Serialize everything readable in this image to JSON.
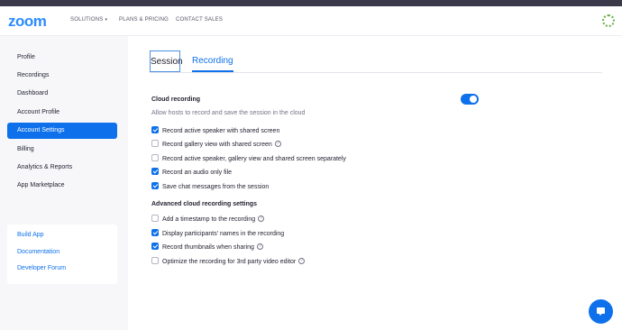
{
  "header": {
    "logo": "zoom",
    "nav": [
      {
        "label": "SOLUTIONS",
        "caret": "▾"
      },
      {
        "label": "PLANS & PRICING"
      },
      {
        "label": "CONTACT SALES"
      }
    ]
  },
  "sidebar": {
    "items": [
      {
        "label": "Profile",
        "active": false
      },
      {
        "label": "Recordings",
        "active": false
      },
      {
        "label": "Dashboard",
        "active": false
      },
      {
        "label": "Account Profile",
        "active": false
      },
      {
        "label": "Account Settings",
        "active": true
      },
      {
        "label": "Billing",
        "active": false
      },
      {
        "label": "Analytics & Reports",
        "active": false
      },
      {
        "label": "App Marketplace",
        "active": false
      }
    ],
    "links": [
      {
        "label": "Build App"
      },
      {
        "label": "Documentation"
      },
      {
        "label": "Developer Forum"
      }
    ]
  },
  "tabs": [
    {
      "label": "Session",
      "selected": false
    },
    {
      "label": "Recording",
      "selected": true
    }
  ],
  "cloud": {
    "title": "Cloud recording",
    "description": "Allow hosts to record and save the session in the cloud",
    "enabled": true,
    "options": [
      {
        "label": "Record active speaker with shared screen",
        "checked": true,
        "info": false
      },
      {
        "label": "Record gallery view with shared screen",
        "checked": false,
        "info": true
      },
      {
        "label": "Record active speaker, gallery view and shared screen separately",
        "checked": false,
        "info": false
      },
      {
        "label": "Record an audio only file",
        "checked": true,
        "info": false
      },
      {
        "label": "Save chat messages from the session",
        "checked": true,
        "info": false
      }
    ]
  },
  "advanced": {
    "title": "Advanced cloud recording settings",
    "options": [
      {
        "label": "Add a timestamp to the recording",
        "checked": false,
        "info": true
      },
      {
        "label": "Display participants' names in the recording",
        "checked": true,
        "info": false
      },
      {
        "label": "Record thumbnails when sharing",
        "checked": true,
        "info": true
      },
      {
        "label": "Optimize the recording for 3rd party video editor",
        "checked": false,
        "info": true
      }
    ]
  },
  "info_glyph": "?",
  "colors": {
    "accent": "#0e71eb",
    "brand": "#2d8cff"
  }
}
